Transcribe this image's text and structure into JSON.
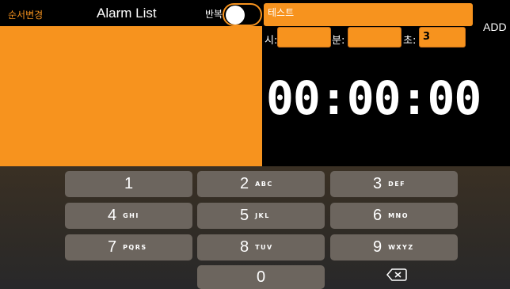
{
  "header": {
    "reorder_label": "순서변경",
    "title": "Alarm List",
    "repeat_label": "반복",
    "repeat_on": false,
    "name_value": "테스트",
    "add_label": "ADD"
  },
  "time_inputs": {
    "hour_label": "시:",
    "hour_value": "",
    "minute_label": "분:",
    "minute_value": "",
    "second_label": "초:",
    "second_value": "3"
  },
  "timer_display": "00:00:00",
  "keypad": {
    "keys": [
      {
        "num": "1",
        "letters": ""
      },
      {
        "num": "2",
        "letters": "ABC"
      },
      {
        "num": "3",
        "letters": "DEF"
      },
      {
        "num": "4",
        "letters": "GHI"
      },
      {
        "num": "5",
        "letters": "JKL"
      },
      {
        "num": "6",
        "letters": "MNO"
      },
      {
        "num": "7",
        "letters": "PQRS"
      },
      {
        "num": "8",
        "letters": "TUV"
      },
      {
        "num": "9",
        "letters": "WXYZ"
      },
      {
        "num": "0",
        "letters": ""
      }
    ],
    "delete_icon": "backspace-icon"
  },
  "colors": {
    "accent": "#f7931e",
    "background": "#000000",
    "key": "#6c655e"
  }
}
